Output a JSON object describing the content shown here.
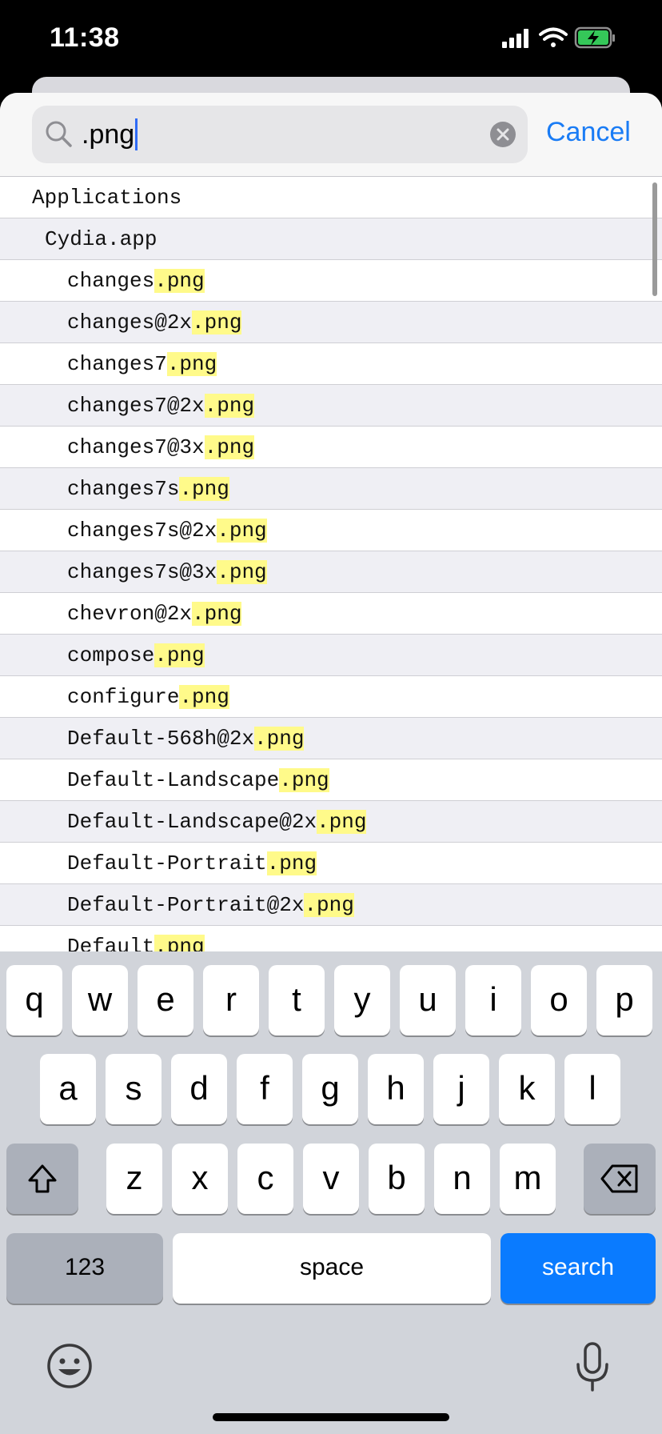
{
  "status": {
    "time": "11:38"
  },
  "search": {
    "query": ".png",
    "cancel_label": "Cancel"
  },
  "list": [
    {
      "indent": 0,
      "name": "Applications",
      "match": ""
    },
    {
      "indent": 1,
      "name": "Cydia.app",
      "match": ""
    },
    {
      "indent": 2,
      "name": "changes",
      "match": ".png"
    },
    {
      "indent": 2,
      "name": "changes@2x",
      "match": ".png"
    },
    {
      "indent": 2,
      "name": "changes7",
      "match": ".png"
    },
    {
      "indent": 2,
      "name": "changes7@2x",
      "match": ".png"
    },
    {
      "indent": 2,
      "name": "changes7@3x",
      "match": ".png"
    },
    {
      "indent": 2,
      "name": "changes7s",
      "match": ".png"
    },
    {
      "indent": 2,
      "name": "changes7s@2x",
      "match": ".png"
    },
    {
      "indent": 2,
      "name": "changes7s@3x",
      "match": ".png"
    },
    {
      "indent": 2,
      "name": "chevron@2x",
      "match": ".png"
    },
    {
      "indent": 2,
      "name": "compose",
      "match": ".png"
    },
    {
      "indent": 2,
      "name": "configure",
      "match": ".png"
    },
    {
      "indent": 2,
      "name": "Default-568h@2x",
      "match": ".png"
    },
    {
      "indent": 2,
      "name": "Default-Landscape",
      "match": ".png"
    },
    {
      "indent": 2,
      "name": "Default-Landscape@2x",
      "match": ".png"
    },
    {
      "indent": 2,
      "name": "Default-Portrait",
      "match": ".png"
    },
    {
      "indent": 2,
      "name": "Default-Portrait@2x",
      "match": ".png"
    },
    {
      "indent": 2,
      "name": "Default",
      "match": ".png"
    }
  ],
  "keyboard": {
    "row1": [
      "q",
      "w",
      "e",
      "r",
      "t",
      "y",
      "u",
      "i",
      "o",
      "p"
    ],
    "row2": [
      "a",
      "s",
      "d",
      "f",
      "g",
      "h",
      "j",
      "k",
      "l"
    ],
    "row3": [
      "z",
      "x",
      "c",
      "v",
      "b",
      "n",
      "m"
    ],
    "numbers_label": "123",
    "space_label": "space",
    "search_label": "search"
  },
  "colors": {
    "accent": "#1a7cf5",
    "search_key": "#0a7bff",
    "highlight": "#fffa8a"
  },
  "icons": [
    "search-icon",
    "clear-icon",
    "shift-icon",
    "backspace-icon",
    "emoji-icon",
    "microphone-icon",
    "signal-icon",
    "wifi-icon",
    "battery-icon"
  ]
}
